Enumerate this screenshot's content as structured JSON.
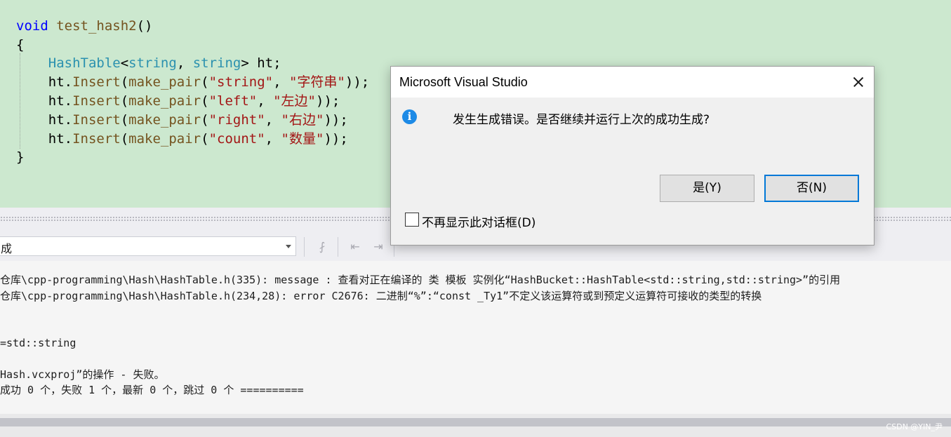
{
  "editor": {
    "lines": [
      {
        "parts": [
          {
            "c": "kw",
            "t": "void"
          },
          {
            "c": "pl",
            "t": " "
          },
          {
            "c": "fn",
            "t": "test_hash2"
          },
          {
            "c": "pl",
            "t": "()"
          }
        ]
      },
      {
        "parts": [
          {
            "c": "pl",
            "t": "{"
          }
        ]
      },
      {
        "parts": [
          {
            "c": "pl",
            "t": "    "
          },
          {
            "c": "ty",
            "t": "HashTable"
          },
          {
            "c": "pl",
            "t": "<"
          },
          {
            "c": "ty",
            "t": "string"
          },
          {
            "c": "pl",
            "t": ", "
          },
          {
            "c": "ty",
            "t": "string"
          },
          {
            "c": "pl",
            "t": "> ht;"
          }
        ]
      },
      {
        "parts": [
          {
            "c": "pl",
            "t": "    ht."
          },
          {
            "c": "fn",
            "t": "Insert"
          },
          {
            "c": "pl",
            "t": "("
          },
          {
            "c": "fn",
            "t": "make_pair"
          },
          {
            "c": "pl",
            "t": "("
          },
          {
            "c": "st",
            "t": "\"string\""
          },
          {
            "c": "pl",
            "t": ", "
          },
          {
            "c": "st",
            "t": "\"字符串\""
          },
          {
            "c": "pl",
            "t": "));"
          }
        ]
      },
      {
        "parts": [
          {
            "c": "pl",
            "t": "    ht."
          },
          {
            "c": "fn",
            "t": "Insert"
          },
          {
            "c": "pl",
            "t": "("
          },
          {
            "c": "fn",
            "t": "make_pair"
          },
          {
            "c": "pl",
            "t": "("
          },
          {
            "c": "st",
            "t": "\"left\""
          },
          {
            "c": "pl",
            "t": ", "
          },
          {
            "c": "st",
            "t": "\"左边\""
          },
          {
            "c": "pl",
            "t": "));"
          }
        ]
      },
      {
        "parts": [
          {
            "c": "pl",
            "t": "    ht."
          },
          {
            "c": "fn",
            "t": "Insert"
          },
          {
            "c": "pl",
            "t": "("
          },
          {
            "c": "fn",
            "t": "make_pair"
          },
          {
            "c": "pl",
            "t": "("
          },
          {
            "c": "st",
            "t": "\"right\""
          },
          {
            "c": "pl",
            "t": ", "
          },
          {
            "c": "st",
            "t": "\"右边\""
          },
          {
            "c": "pl",
            "t": "));"
          }
        ]
      },
      {
        "parts": [
          {
            "c": "pl",
            "t": "    ht."
          },
          {
            "c": "fn",
            "t": "Insert"
          },
          {
            "c": "pl",
            "t": "("
          },
          {
            "c": "fn",
            "t": "make_pair"
          },
          {
            "c": "pl",
            "t": "("
          },
          {
            "c": "st",
            "t": "\"count\""
          },
          {
            "c": "pl",
            "t": ", "
          },
          {
            "c": "st",
            "t": "\"数量\""
          },
          {
            "c": "pl",
            "t": "));"
          }
        ]
      },
      {
        "parts": [
          {
            "c": "pl",
            "t": "}"
          }
        ]
      }
    ]
  },
  "output": {
    "source_selected": "成",
    "lines": [
      "仓库\\cpp-programming\\Hash\\HashTable.h(335): message : 查看对正在编译的 类 模板 实例化“HashBucket::HashTable<std::string,std::string>”的引用",
      "仓库\\cpp-programming\\Hash\\HashTable.h(234,28): error C2676: 二进制“%”:“const _Ty1”不定义该运算符或到预定义运算符可接收的类型的转换",
      "",
      "",
      "=std::string",
      "",
      "Hash.vcxproj”的操作 - 失败。",
      "成功 0 个，失败 1 个，最新 0 个，跳过 0 个 =========="
    ]
  },
  "dialog": {
    "title": "Microsoft Visual Studio",
    "message": "发生生成错误。是否继续并运行上次的成功生成?",
    "yes_label": "是(Y)",
    "no_label": "否(N)",
    "checkbox_label": "不再显示此对话框(D)",
    "checkbox_checked": false
  },
  "watermark": "CSDN @YIN_尹",
  "colors": {
    "editor_bg": "#cce8cf",
    "keyword": "#0000ff",
    "function": "#74531f",
    "type": "#2b91af",
    "string": "#a31515",
    "info_icon": "#1d8ae6",
    "default_button_border": "#0078d7"
  }
}
